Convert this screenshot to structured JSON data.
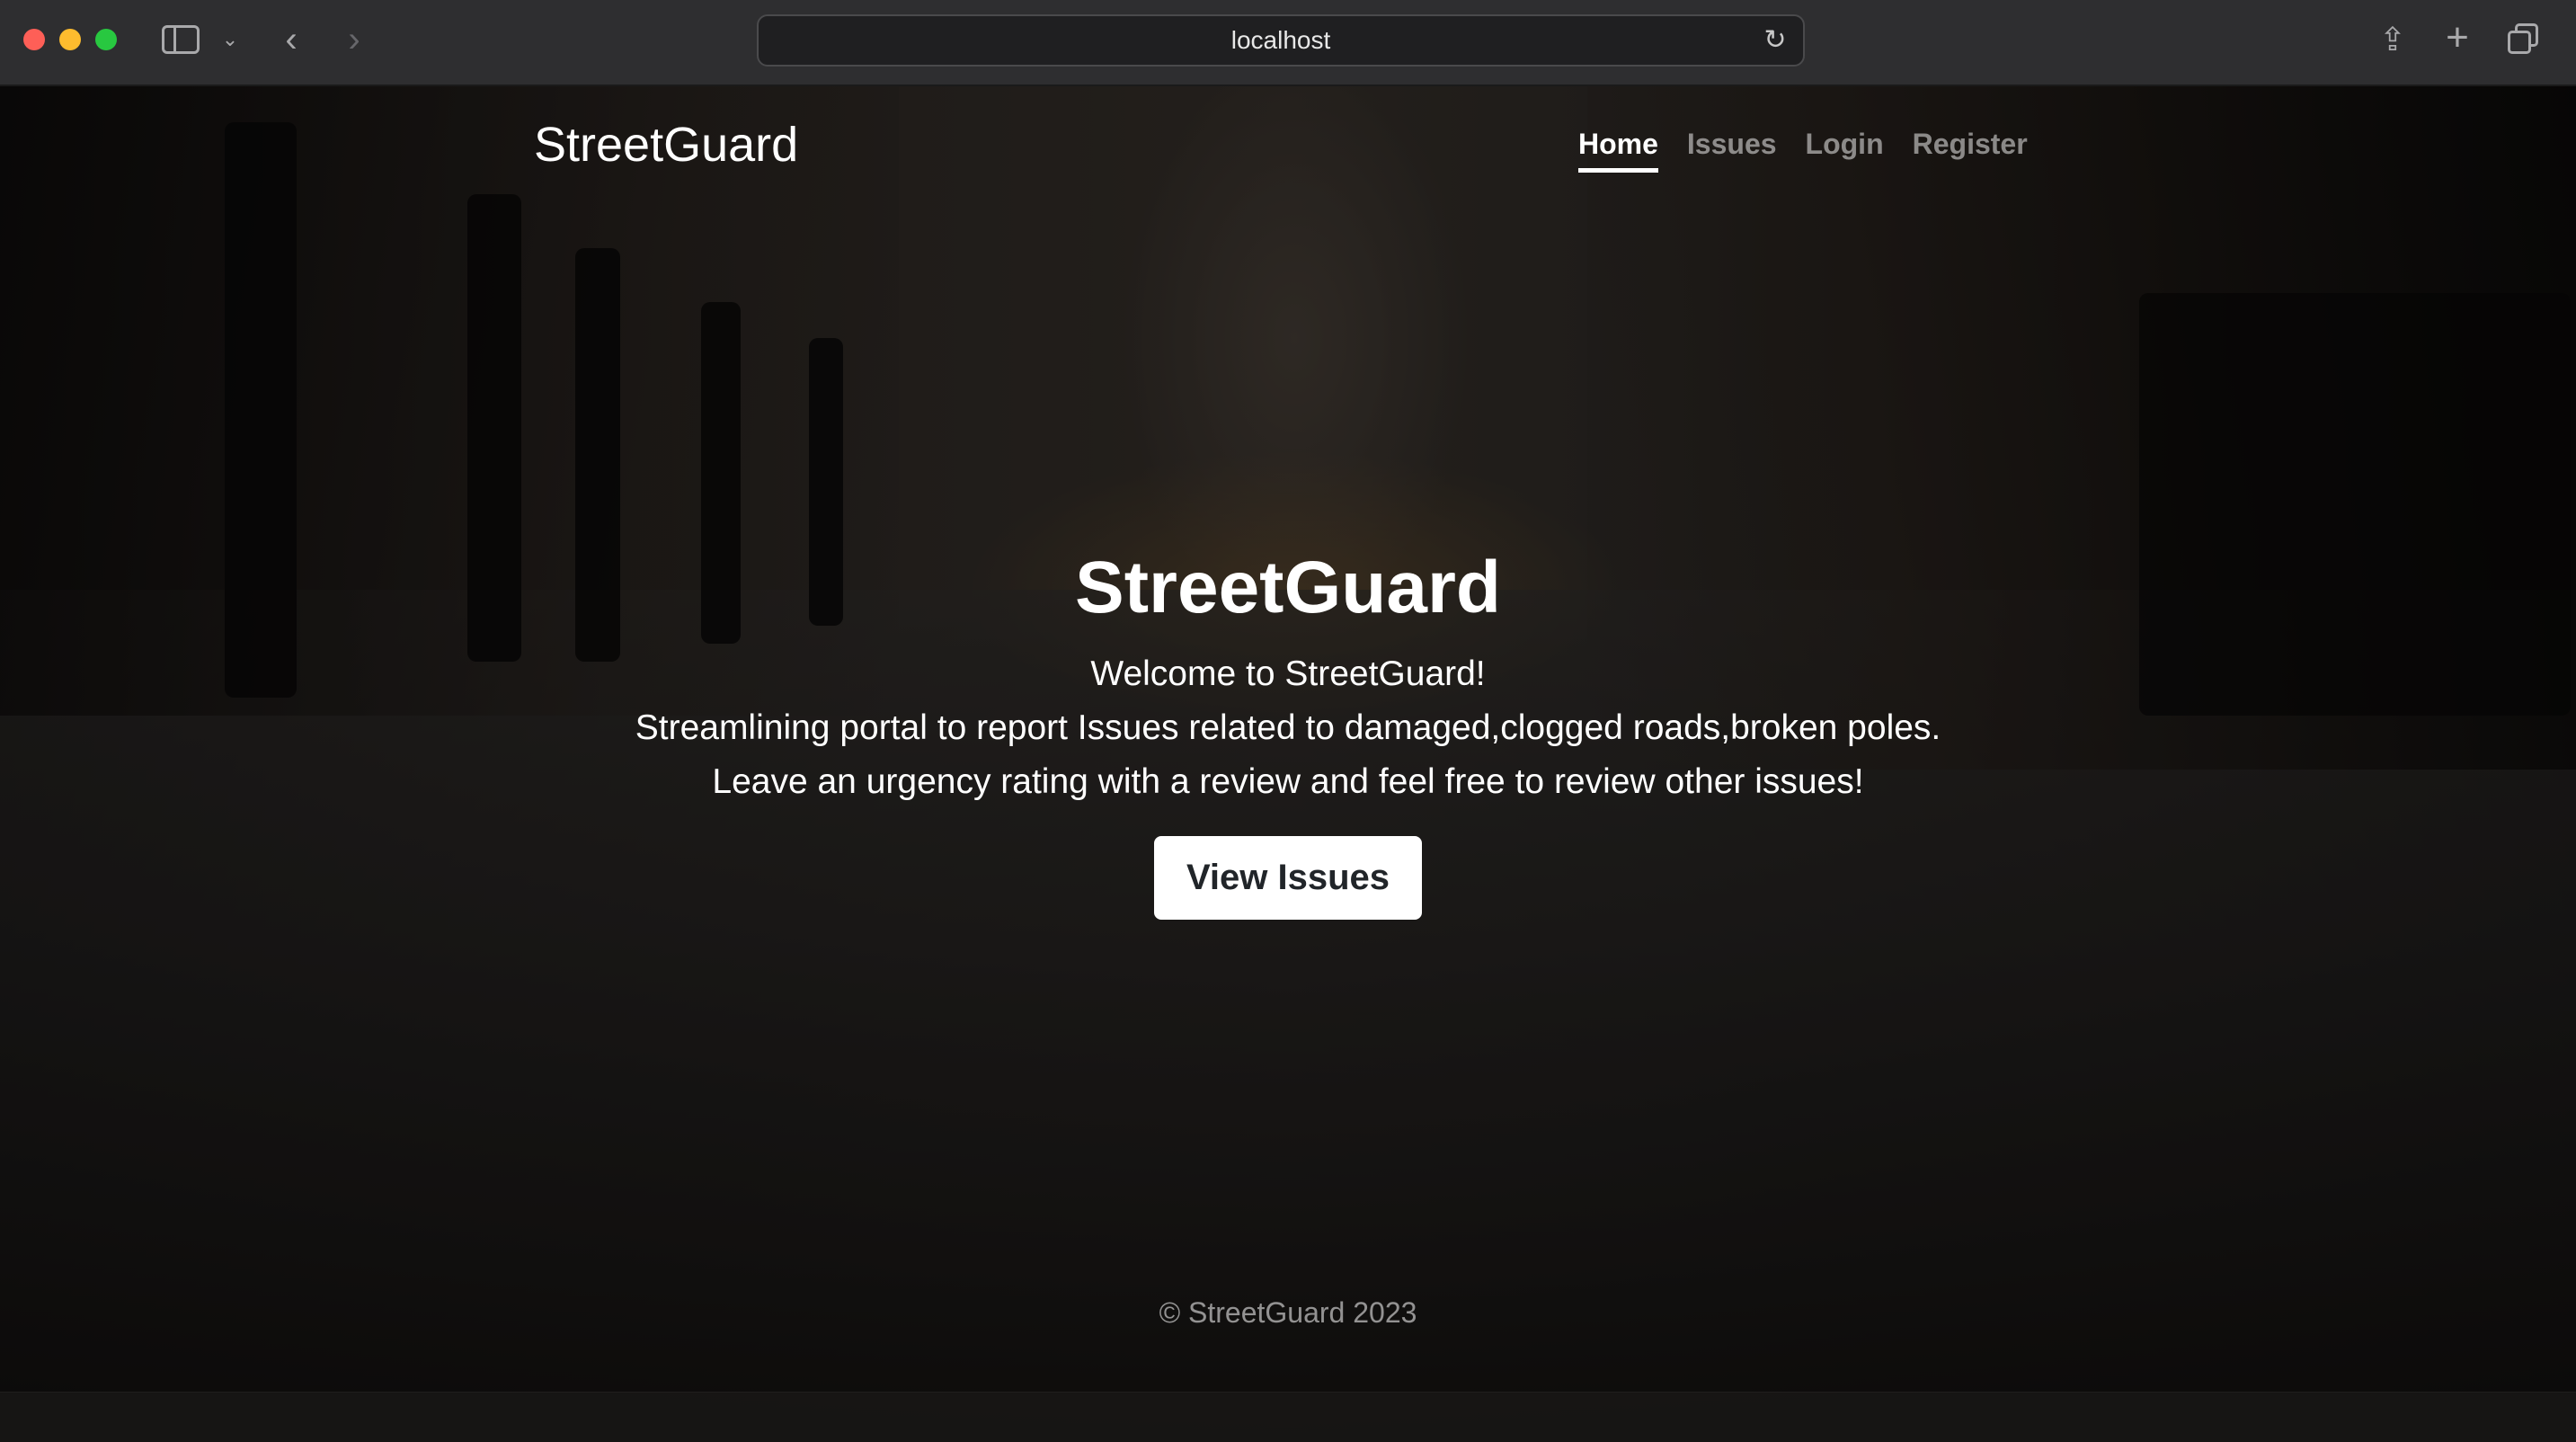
{
  "browser": {
    "url": "localhost",
    "icons": {
      "sidebar": "sidebar-icon",
      "sidebar_menu": "chevron-down-icon",
      "back": "chevron-left-icon",
      "forward": "chevron-right-icon",
      "reload": "reload-icon",
      "share": "share-icon",
      "new_tab": "plus-icon",
      "tab_overview": "tabs-icon"
    }
  },
  "navbar": {
    "brand": "StreetGuard",
    "links": [
      {
        "label": "Home",
        "active": true
      },
      {
        "label": "Issues",
        "active": false
      },
      {
        "label": "Login",
        "active": false
      },
      {
        "label": "Register",
        "active": false
      }
    ]
  },
  "hero": {
    "title": "StreetGuard",
    "lines": [
      "Welcome to StreetGuard!",
      "Streamlining portal to report Issues related to damaged,clogged roads,broken poles.",
      "Leave an urgency rating with a review and feel free to review other issues!"
    ],
    "cta_label": "View Issues"
  },
  "footer": {
    "text": "© StreetGuard 2023"
  },
  "colors": {
    "chrome_bg": "#2e2e30",
    "address_bg": "#1f1f21",
    "button_bg": "#ffffff",
    "button_text": "#212529",
    "nav_inactive": "rgba(255,255,255,0.5)"
  }
}
